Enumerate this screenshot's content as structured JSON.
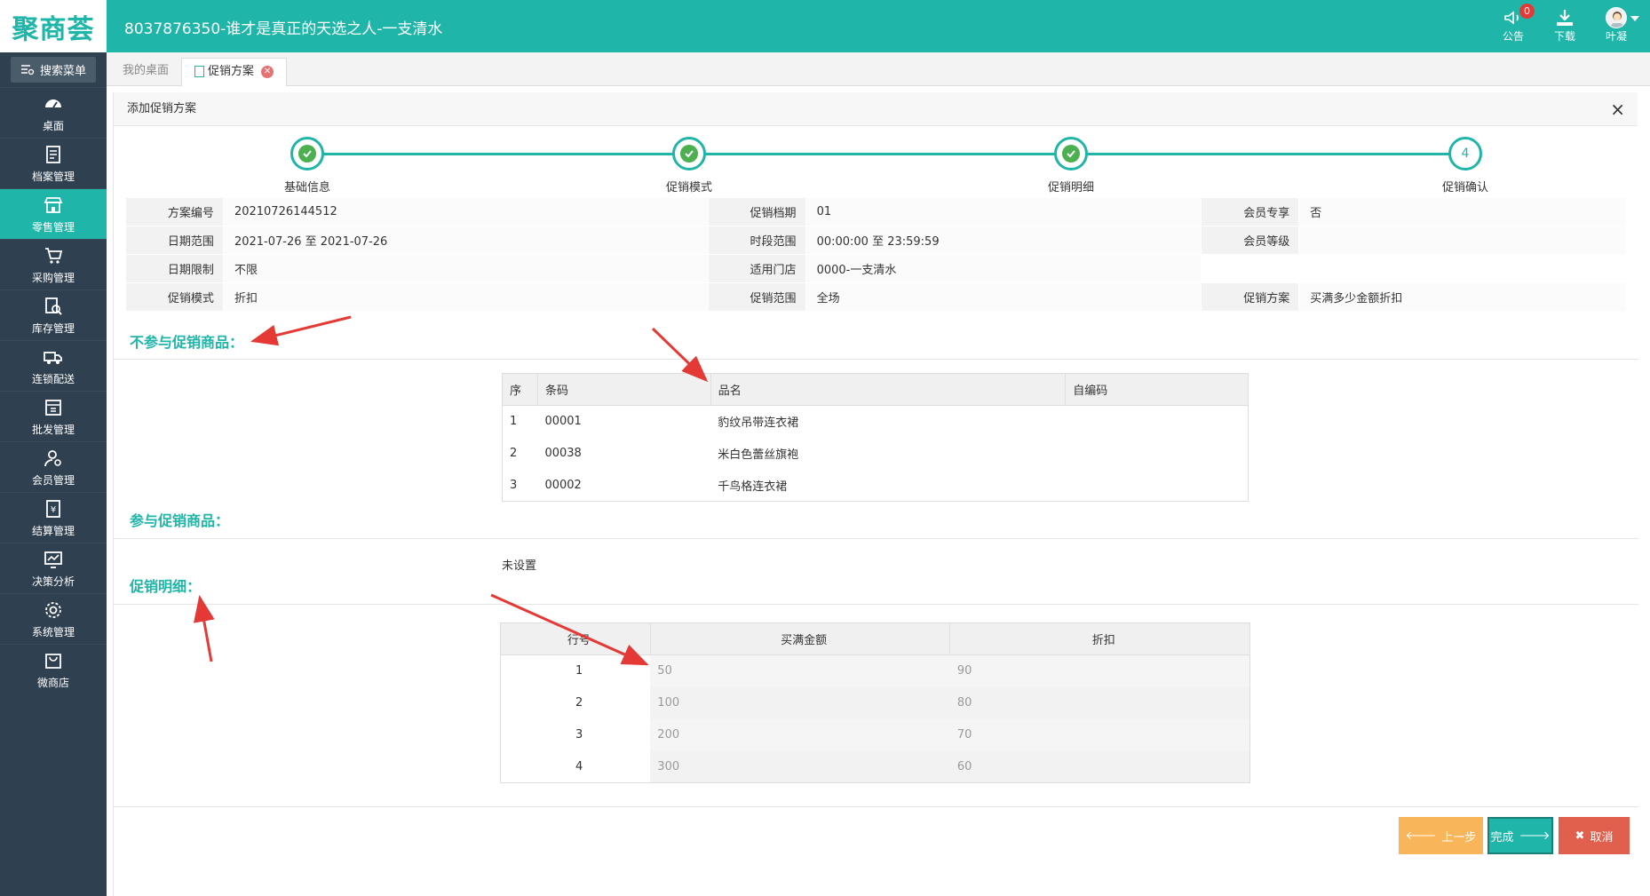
{
  "topbar": {
    "logo": "聚商荟",
    "title": "8037876350-谁才是真正的天选之人-一支清水",
    "actions": [
      {
        "label": "公告",
        "icon": "megaphone-icon",
        "badge": "0"
      },
      {
        "label": "下载",
        "icon": "download-icon"
      },
      {
        "label": "叶凝",
        "icon": "avatar"
      }
    ]
  },
  "sidebar": {
    "search_label": "搜索菜单",
    "items": [
      {
        "label": "桌面",
        "icon": "dashboard-icon"
      },
      {
        "label": "档案管理",
        "icon": "archive-icon"
      },
      {
        "label": "零售管理",
        "icon": "store-icon",
        "active": true
      },
      {
        "label": "采购管理",
        "icon": "cart-icon"
      },
      {
        "label": "库存管理",
        "icon": "inventory-icon"
      },
      {
        "label": "连锁配送",
        "icon": "truck-icon"
      },
      {
        "label": "批发管理",
        "icon": "wholesale-icon"
      },
      {
        "label": "会员管理",
        "icon": "member-icon"
      },
      {
        "label": "结算管理",
        "icon": "settlement-icon"
      },
      {
        "label": "决策分析",
        "icon": "analysis-icon"
      },
      {
        "label": "系统管理",
        "icon": "gear-icon"
      },
      {
        "label": "微商店",
        "icon": "shop-bag-icon"
      }
    ]
  },
  "tabs": [
    {
      "label": "我的桌面"
    },
    {
      "label": "促销方案",
      "active": true
    }
  ],
  "panel": {
    "title": "添加促销方案",
    "steps": [
      {
        "label": "基础信息",
        "done": true
      },
      {
        "label": "促销模式",
        "done": true
      },
      {
        "label": "促销明细",
        "done": true
      },
      {
        "label": "促销确认",
        "number": "4"
      }
    ],
    "info": {
      "rows": [
        [
          {
            "label": "方案编号",
            "value": "20210726144512"
          },
          {
            "label": "促销档期",
            "value": "01"
          },
          {
            "label": "会员专享",
            "value": "否"
          }
        ],
        [
          {
            "label": "日期范围",
            "value": "2021-07-26 至 2021-07-26"
          },
          {
            "label": "时段范围",
            "value": "00:00:00 至 23:59:59"
          },
          {
            "label": "会员等级",
            "value": ""
          }
        ],
        [
          {
            "label": "日期限制",
            "value": "不限"
          },
          {
            "label": "适用门店",
            "value": "0000-一支清水"
          },
          {
            "label": "",
            "value": ""
          }
        ],
        [
          {
            "label": "促销模式",
            "value": "折扣"
          },
          {
            "label": "促销范围",
            "value": "全场"
          },
          {
            "label": "促销方案",
            "value": "买满多少金额折扣"
          }
        ]
      ]
    },
    "excluded": {
      "title": "不参与促销商品：",
      "headers": [
        "序",
        "条码",
        "品名",
        "自编码"
      ],
      "rows": [
        [
          "1",
          "00001",
          "豹纹吊带连衣裙",
          ""
        ],
        [
          "2",
          "00038",
          "米白色蕾丝旗袍",
          ""
        ],
        [
          "3",
          "00002",
          "千鸟格连衣裙",
          ""
        ]
      ]
    },
    "included": {
      "title": "参与促销商品：",
      "empty": "未设置"
    },
    "detail": {
      "title": "促销明细：",
      "headers": [
        "行号",
        "买满金额",
        "折扣"
      ],
      "rows": [
        [
          "1",
          "50",
          "90"
        ],
        [
          "2",
          "100",
          "80"
        ],
        [
          "3",
          "200",
          "70"
        ],
        [
          "4",
          "300",
          "60"
        ]
      ]
    },
    "buttons": {
      "prev": "上一步",
      "done": "完成",
      "cancel": "取消"
    }
  },
  "colors": {
    "accent": "#1fb5a8",
    "sidebar": "#2f4050",
    "prev": "#f8b55a",
    "cancel": "#e0604d",
    "annotation": "#e53935"
  }
}
